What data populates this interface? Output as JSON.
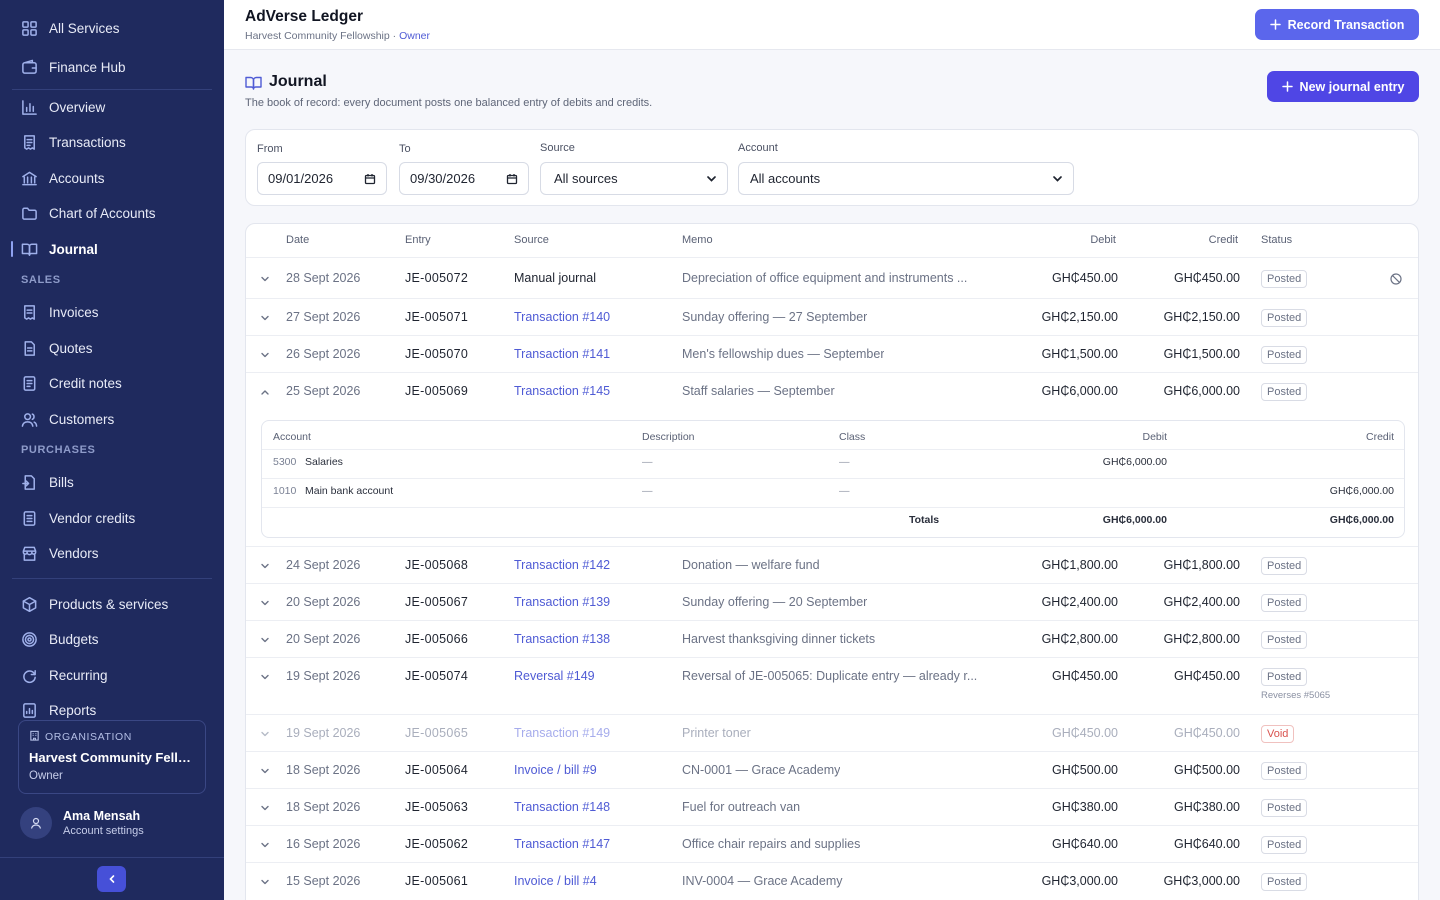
{
  "sidebar": {
    "top_items": [
      {
        "label": "All Services",
        "icon": "grid-icon"
      },
      {
        "label": "Finance Hub",
        "icon": "wallet-icon"
      }
    ],
    "main_items": [
      {
        "label": "Overview",
        "icon": "bar-chart-icon"
      },
      {
        "label": "Transactions",
        "icon": "receipt-icon"
      },
      {
        "label": "Accounts",
        "icon": "bank-icon"
      },
      {
        "label": "Chart of Accounts",
        "icon": "folder-icon"
      },
      {
        "label": "Journal",
        "icon": "book-icon",
        "active": true
      }
    ],
    "sales_title": "SALES",
    "sales_items": [
      {
        "label": "Invoices",
        "icon": "invoice-icon"
      },
      {
        "label": "Quotes",
        "icon": "document-icon"
      },
      {
        "label": "Credit notes",
        "icon": "credit-note-icon"
      },
      {
        "label": "Customers",
        "icon": "users-icon"
      }
    ],
    "purchases_title": "PURCHASES",
    "purchases_items": [
      {
        "label": "Bills",
        "icon": "bill-icon"
      },
      {
        "label": "Vendor credits",
        "icon": "vendor-credit-icon"
      },
      {
        "label": "Vendors",
        "icon": "store-icon"
      }
    ],
    "other_items": [
      {
        "label": "Products & services",
        "icon": "box-icon"
      },
      {
        "label": "Budgets",
        "icon": "target-icon"
      },
      {
        "label": "Recurring",
        "icon": "refresh-icon"
      },
      {
        "label": "Reports",
        "icon": "report-icon"
      }
    ],
    "org": {
      "label": "ORGANISATION",
      "name": "Harvest Community Fellowship",
      "role": "Owner"
    },
    "user": {
      "name": "Ama Mensah",
      "sub": "Account settings"
    }
  },
  "header": {
    "title": "AdVerse Ledger",
    "org": "Harvest Community Fellowship",
    "separator": " · ",
    "role": "Owner",
    "record_button": "Record Transaction"
  },
  "page": {
    "title": "Journal",
    "description": "The book of record: every document posts one balanced entry of debits and credits.",
    "new_button": "New journal entry"
  },
  "filters": {
    "from_label": "From",
    "from_value": "09/01/2026",
    "to_label": "To",
    "to_value": "09/30/2026",
    "source_label": "Source",
    "source_value": "All sources",
    "account_label": "Account",
    "account_value": "All accounts"
  },
  "table": {
    "headers": {
      "date": "Date",
      "entry": "Entry",
      "source": "Source",
      "memo": "Memo",
      "debit": "Debit",
      "credit": "Credit",
      "status": "Status"
    },
    "rows": [
      {
        "date": "28 Sept 2026",
        "entry": "JE-005072",
        "source": "Manual journal",
        "source_link": false,
        "memo": "Depreciation of office equipment and instruments ...",
        "debit": "GH₵450.00",
        "credit": "GH₵450.00",
        "status": "Posted",
        "void_action": true
      },
      {
        "date": "27 Sept 2026",
        "entry": "JE-005071",
        "source": "Transaction #140",
        "source_link": true,
        "memo": "Sunday offering — 27 September",
        "debit": "GH₵2,150.00",
        "credit": "GH₵2,150.00",
        "status": "Posted"
      },
      {
        "date": "26 Sept 2026",
        "entry": "JE-005070",
        "source": "Transaction #141",
        "source_link": true,
        "memo": "Men's fellowship dues — September",
        "debit": "GH₵1,500.00",
        "credit": "GH₵1,500.00",
        "status": "Posted"
      },
      {
        "date": "25 Sept 2026",
        "entry": "JE-005069",
        "source": "Transaction #145",
        "source_link": true,
        "memo": "Staff salaries — September",
        "debit": "GH₵6,000.00",
        "credit": "GH₵6,000.00",
        "status": "Posted",
        "expanded": true
      },
      {
        "date": "24 Sept 2026",
        "entry": "JE-005068",
        "source": "Transaction #142",
        "source_link": true,
        "memo": "Donation — welfare fund",
        "debit": "GH₵1,800.00",
        "credit": "GH₵1,800.00",
        "status": "Posted"
      },
      {
        "date": "20 Sept 2026",
        "entry": "JE-005067",
        "source": "Transaction #139",
        "source_link": true,
        "memo": "Sunday offering — 20 September",
        "debit": "GH₵2,400.00",
        "credit": "GH₵2,400.00",
        "status": "Posted"
      },
      {
        "date": "20 Sept 2026",
        "entry": "JE-005066",
        "source": "Transaction #138",
        "source_link": true,
        "memo": "Harvest thanksgiving dinner tickets",
        "debit": "GH₵2,800.00",
        "credit": "GH₵2,800.00",
        "status": "Posted"
      },
      {
        "date": "19 Sept 2026",
        "entry": "JE-005074",
        "source": "Reversal #149",
        "source_link": true,
        "memo": "Reversal of JE-005065: Duplicate entry — already r...",
        "debit": "GH₵450.00",
        "credit": "GH₵450.00",
        "status": "Posted",
        "note": "Reverses #5065"
      },
      {
        "date": "19 Sept 2026",
        "entry": "JE-005065",
        "source": "Transaction #149",
        "source_link": true,
        "memo": "Printer toner",
        "debit": "GH₵450.00",
        "credit": "GH₵450.00",
        "status": "Void",
        "voided": true
      },
      {
        "date": "18 Sept 2026",
        "entry": "JE-005064",
        "source": "Invoice / bill #9",
        "source_link": true,
        "memo": "CN-0001 — Grace Academy",
        "debit": "GH₵500.00",
        "credit": "GH₵500.00",
        "status": "Posted"
      },
      {
        "date": "18 Sept 2026",
        "entry": "JE-005063",
        "source": "Transaction #148",
        "source_link": true,
        "memo": "Fuel for outreach van",
        "debit": "GH₵380.00",
        "credit": "GH₵380.00",
        "status": "Posted"
      },
      {
        "date": "16 Sept 2026",
        "entry": "JE-005062",
        "source": "Transaction #147",
        "source_link": true,
        "memo": "Office chair repairs and supplies",
        "debit": "GH₵640.00",
        "credit": "GH₵640.00",
        "status": "Posted"
      },
      {
        "date": "15 Sept 2026",
        "entry": "JE-005061",
        "source": "Invoice / bill #4",
        "source_link": true,
        "memo": "INV-0004 — Grace Academy",
        "debit": "GH₵3,000.00",
        "credit": "GH₵3,000.00",
        "status": "Posted"
      }
    ],
    "detail": {
      "headers": {
        "account": "Account",
        "description": "Description",
        "class": "Class",
        "debit": "Debit",
        "credit": "Credit"
      },
      "lines": [
        {
          "code": "5300",
          "account": "Salaries",
          "description": "—",
          "class": "—",
          "debit": "GH₵6,000.00",
          "credit": ""
        },
        {
          "code": "1010",
          "account": "Main bank account",
          "description": "—",
          "class": "—",
          "debit": "",
          "credit": "GH₵6,000.00"
        }
      ],
      "totals_label": "Totals",
      "total_debit": "GH₵6,000.00",
      "total_credit": "GH₵6,000.00"
    }
  },
  "colors": {
    "sidebar_bg": "#1f2a5e",
    "accent": "#4f46e5",
    "link": "#4f5bd5",
    "void": "#d9534f"
  }
}
